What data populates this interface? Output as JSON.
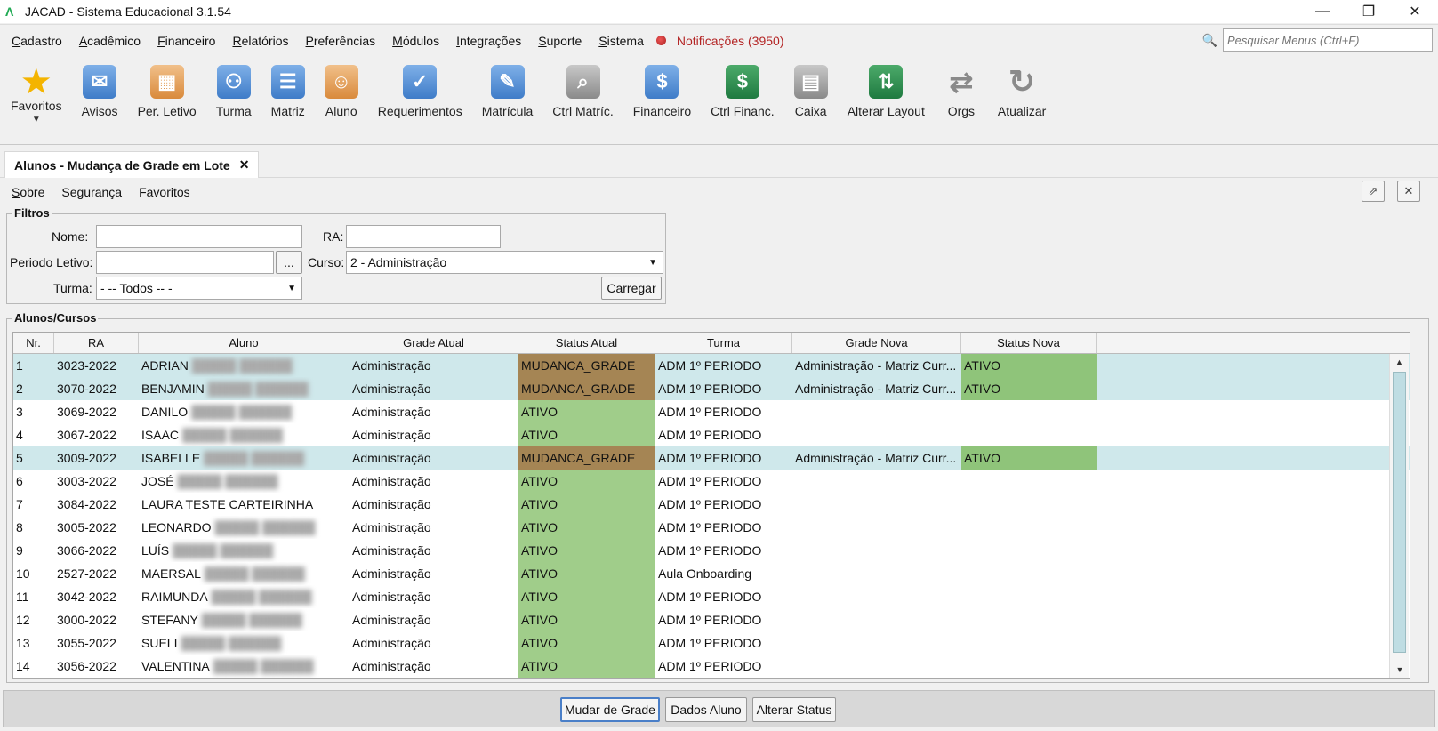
{
  "window": {
    "title": "JACAD - Sistema Educacional 3.1.54"
  },
  "menu": {
    "items": [
      "Cadastro",
      "Acadêmico",
      "Financeiro",
      "Relatórios",
      "Preferências",
      "Módulos",
      "Integrações",
      "Suporte",
      "Sistema"
    ],
    "notifications": "Notificações (3950)",
    "search_placeholder": "Pesquisar Menus (Ctrl+F)"
  },
  "toolbar": [
    {
      "label": "Favoritos",
      "icon": "star-icon"
    },
    {
      "label": "Avisos",
      "icon": "envelope-icon"
    },
    {
      "label": "Per. Letivo",
      "icon": "calendar-icon"
    },
    {
      "label": "Turma",
      "icon": "class-group-icon"
    },
    {
      "label": "Matriz",
      "icon": "matrix-icon"
    },
    {
      "label": "Aluno",
      "icon": "student-icon"
    },
    {
      "label": "Requerimentos",
      "icon": "request-icon"
    },
    {
      "label": "Matrícula",
      "icon": "enrollment-icon"
    },
    {
      "label": "Ctrl Matríc.",
      "icon": "enrollment-control-icon"
    },
    {
      "label": "Financeiro",
      "icon": "finance-icon"
    },
    {
      "label": "Ctrl Financ.",
      "icon": "finance-control-icon"
    },
    {
      "label": "Caixa",
      "icon": "cash-register-icon"
    },
    {
      "label": "Alterar Layout",
      "icon": "layout-icon"
    },
    {
      "label": "Orgs",
      "icon": "swap-arrows-icon"
    },
    {
      "label": "Atualizar",
      "icon": "refresh-icon"
    }
  ],
  "tab": {
    "title": "Alunos - Mudança de Grade em Lote"
  },
  "submenu": {
    "sobre": "Sobre",
    "seguranca": "Segurança",
    "favoritos": "Favoritos"
  },
  "filters": {
    "legend": "Filtros",
    "nome_label": "Nome:",
    "nome_value": "",
    "ra_label": "RA:",
    "ra_value": "",
    "periodo_label": "Periodo Letivo:",
    "periodo_value": "",
    "periodo_button": "...",
    "curso_label": "Curso:",
    "curso_value": "2 - Administração",
    "turma_label": "Turma:",
    "turma_value": "- -- Todos -- -",
    "carregar": "Carregar"
  },
  "grid": {
    "legend": "Alunos/Cursos",
    "headers": [
      "Nr.",
      "RA",
      "Aluno",
      "Grade Atual",
      "Status Atual",
      "Turma",
      "Grade Nova",
      "Status Nova"
    ],
    "rows": [
      {
        "nr": "1",
        "ra": "3023-2022",
        "aluno": "ADRIAN",
        "grade": "Administração",
        "status": "MUDANCA_GRADE",
        "turma": "ADM 1º PERIODO",
        "gnova": "Administração - Matriz Curr...",
        "snova": "ATIVO",
        "selected": true
      },
      {
        "nr": "2",
        "ra": "3070-2022",
        "aluno": "BENJAMIN",
        "grade": "Administração",
        "status": "MUDANCA_GRADE",
        "turma": "ADM 1º PERIODO",
        "gnova": "Administração - Matriz Curr...",
        "snova": "ATIVO",
        "selected": true
      },
      {
        "nr": "3",
        "ra": "3069-2022",
        "aluno": "DANILO",
        "grade": "Administração",
        "status": "ATIVO",
        "turma": "ADM 1º PERIODO",
        "gnova": "",
        "snova": "",
        "selected": false
      },
      {
        "nr": "4",
        "ra": "3067-2022",
        "aluno": "ISAAC",
        "grade": "Administração",
        "status": "ATIVO",
        "turma": "ADM 1º PERIODO",
        "gnova": "",
        "snova": "",
        "selected": false
      },
      {
        "nr": "5",
        "ra": "3009-2022",
        "aluno": "ISABELLE",
        "grade": "Administração",
        "status": "MUDANCA_GRADE",
        "turma": "ADM 1º PERIODO",
        "gnova": "Administração - Matriz Curr...",
        "snova": "ATIVO",
        "selected": true
      },
      {
        "nr": "6",
        "ra": "3003-2022",
        "aluno": "JOSÉ",
        "grade": "Administração",
        "status": "ATIVO",
        "turma": "ADM 1º PERIODO",
        "gnova": "",
        "snova": "",
        "selected": false
      },
      {
        "nr": "7",
        "ra": "3084-2022",
        "aluno": "LAURA TESTE CARTEIRINHA",
        "grade": "Administração",
        "status": "ATIVO",
        "turma": "ADM 1º PERIODO",
        "gnova": "",
        "snova": "",
        "selected": false
      },
      {
        "nr": "8",
        "ra": "3005-2022",
        "aluno": "LEONARDO",
        "grade": "Administração",
        "status": "ATIVO",
        "turma": "ADM 1º PERIODO",
        "gnova": "",
        "snova": "",
        "selected": false
      },
      {
        "nr": "9",
        "ra": "3066-2022",
        "aluno": "LUÍS",
        "grade": "Administração",
        "status": "ATIVO",
        "turma": "ADM 1º PERIODO",
        "gnova": "",
        "snova": "",
        "selected": false
      },
      {
        "nr": "10",
        "ra": "2527-2022",
        "aluno": "MAERSAL",
        "grade": "Administração",
        "status": "ATIVO",
        "turma": "Aula Onboarding",
        "gnova": "",
        "snova": "",
        "selected": false
      },
      {
        "nr": "11",
        "ra": "3042-2022",
        "aluno": "RAIMUNDA",
        "grade": "Administração",
        "status": "ATIVO",
        "turma": "ADM 1º PERIODO",
        "gnova": "",
        "snova": "",
        "selected": false
      },
      {
        "nr": "12",
        "ra": "3000-2022",
        "aluno": "STEFANY",
        "grade": "Administração",
        "status": "ATIVO",
        "turma": "ADM 1º PERIODO",
        "gnova": "",
        "snova": "",
        "selected": false
      },
      {
        "nr": "13",
        "ra": "3055-2022",
        "aluno": "SUELI",
        "grade": "Administração",
        "status": "ATIVO",
        "turma": "ADM 1º PERIODO",
        "gnova": "",
        "snova": "",
        "selected": false
      },
      {
        "nr": "14",
        "ra": "3056-2022",
        "aluno": "VALENTINA",
        "grade": "Administração",
        "status": "ATIVO",
        "turma": "ADM 1º PERIODO",
        "gnova": "",
        "snova": "",
        "selected": false
      }
    ]
  },
  "actions": {
    "mudar_grade": "Mudar de Grade",
    "dados_aluno": "Dados Aluno",
    "alterar_status": "Alterar Status"
  },
  "colors": {
    "selected_row": "#cfe8eb",
    "status_ativo": "#a0cd8a",
    "status_mudanca": "#a58554",
    "notification": "#b32424"
  }
}
